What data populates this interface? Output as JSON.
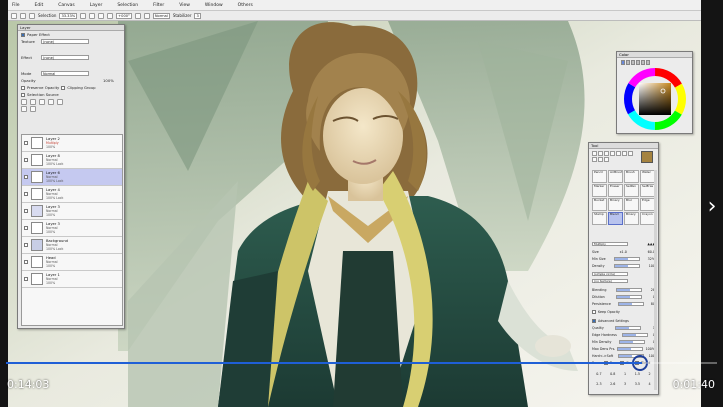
{
  "menu": [
    "File",
    "Edit",
    "Canvas",
    "Layer",
    "Selection",
    "Filter",
    "View",
    "Window",
    "Others"
  ],
  "toolbar": {
    "selection_label": "Selection",
    "zoom": "33.33%",
    "angle": "+000°",
    "mode_label": "Normal",
    "stabilizer_label": "Stabilizer",
    "stabilizer_value": "3"
  },
  "layer_panel": {
    "title": "Layer",
    "paper_effect": "Paper Effect",
    "texture_label": "Texture",
    "texture_value": "(none)",
    "effect_label": "Effect",
    "effect_value": "(none)",
    "mode_label": "Mode",
    "mode_value": "Normal",
    "opacity_label": "Opacity",
    "opacity_value": "100%",
    "preserve_opacity": "Preserve Opacity",
    "clipping_group": "Clipping Group",
    "selection_source": "Selection Source",
    "layers": [
      {
        "name": "Layer 2",
        "blend": "Multiply",
        "opacity": "100%"
      },
      {
        "name": "Layer 8",
        "blend": "Normal",
        "opacity": "100% Lock"
      },
      {
        "name": "Layer 6",
        "blend": "Normal",
        "opacity": "100% Lock"
      },
      {
        "name": "Layer 4",
        "blend": "Normal",
        "opacity": "100% Lock"
      },
      {
        "name": "Layer 3",
        "blend": "Normal",
        "opacity": "100%"
      },
      {
        "name": "Layer 3",
        "blend": "Normal",
        "opacity": "100%"
      },
      {
        "name": "Background",
        "blend": "Normal",
        "opacity": "100% Lock"
      },
      {
        "name": "Head",
        "blend": "Normal",
        "opacity": "100%"
      },
      {
        "name": "Layer 1",
        "blend": "Normal",
        "opacity": "100%"
      }
    ]
  },
  "color_panel": {
    "title": "Color"
  },
  "tool_panel": {
    "title": "Tool",
    "tools": [
      "Pencil",
      "AirBrush",
      "Brush",
      "Water",
      "Marker",
      "Eraser",
      "SelPen",
      "SelEras",
      "Bucket",
      "Binary",
      "Blur",
      "Edge",
      "Stamp",
      "Blend",
      "Binary",
      "Crayon"
    ],
    "brush_shape": "Multiply",
    "size_label": "Size",
    "size_value": "x1.0",
    "size_num": "60.0",
    "min_size_label": "Min Size",
    "min_size_value": "32%",
    "density_label": "Density",
    "density_value": "100",
    "shape_value": "(simple circle)",
    "texture_value": "(no texture)",
    "blending_label": "Blending",
    "blending_value": "28",
    "dilution_label": "Dilution",
    "dilution_value": "0",
    "persistence_label": "Persistence",
    "persistence_value": "80",
    "keep_opacity": "Keep Opacity",
    "advanced_label": "Advanced Settings",
    "quality_label": "Quality",
    "quality_value": "1",
    "edge_hardness_label": "Edge Hardness",
    "edge_hardness_value": "0",
    "min_density_label": "Min Density",
    "min_density_value": "0",
    "max_dens_prs_label": "Max Dens Prs.",
    "max_dens_prs_value": "100%",
    "hard_soft_label": "Hard<->Soft",
    "hard_soft_value": "100",
    "press_label": "Press:",
    "press_flags": [
      "Dens",
      "Size",
      "Blend"
    ],
    "size_presets": [
      "0.7",
      "0.8",
      "1",
      "1.5",
      "2",
      "2.3",
      "2.6",
      "3",
      "3.5",
      "4"
    ]
  },
  "video": {
    "current_time": "0:14:03",
    "remaining_time": "0:01:40",
    "progress": 0.894
  },
  "colors": {
    "progress": "#1f5fd6",
    "selected_layer": "#c5c9f0",
    "foreground_swatch": "#a58340"
  }
}
